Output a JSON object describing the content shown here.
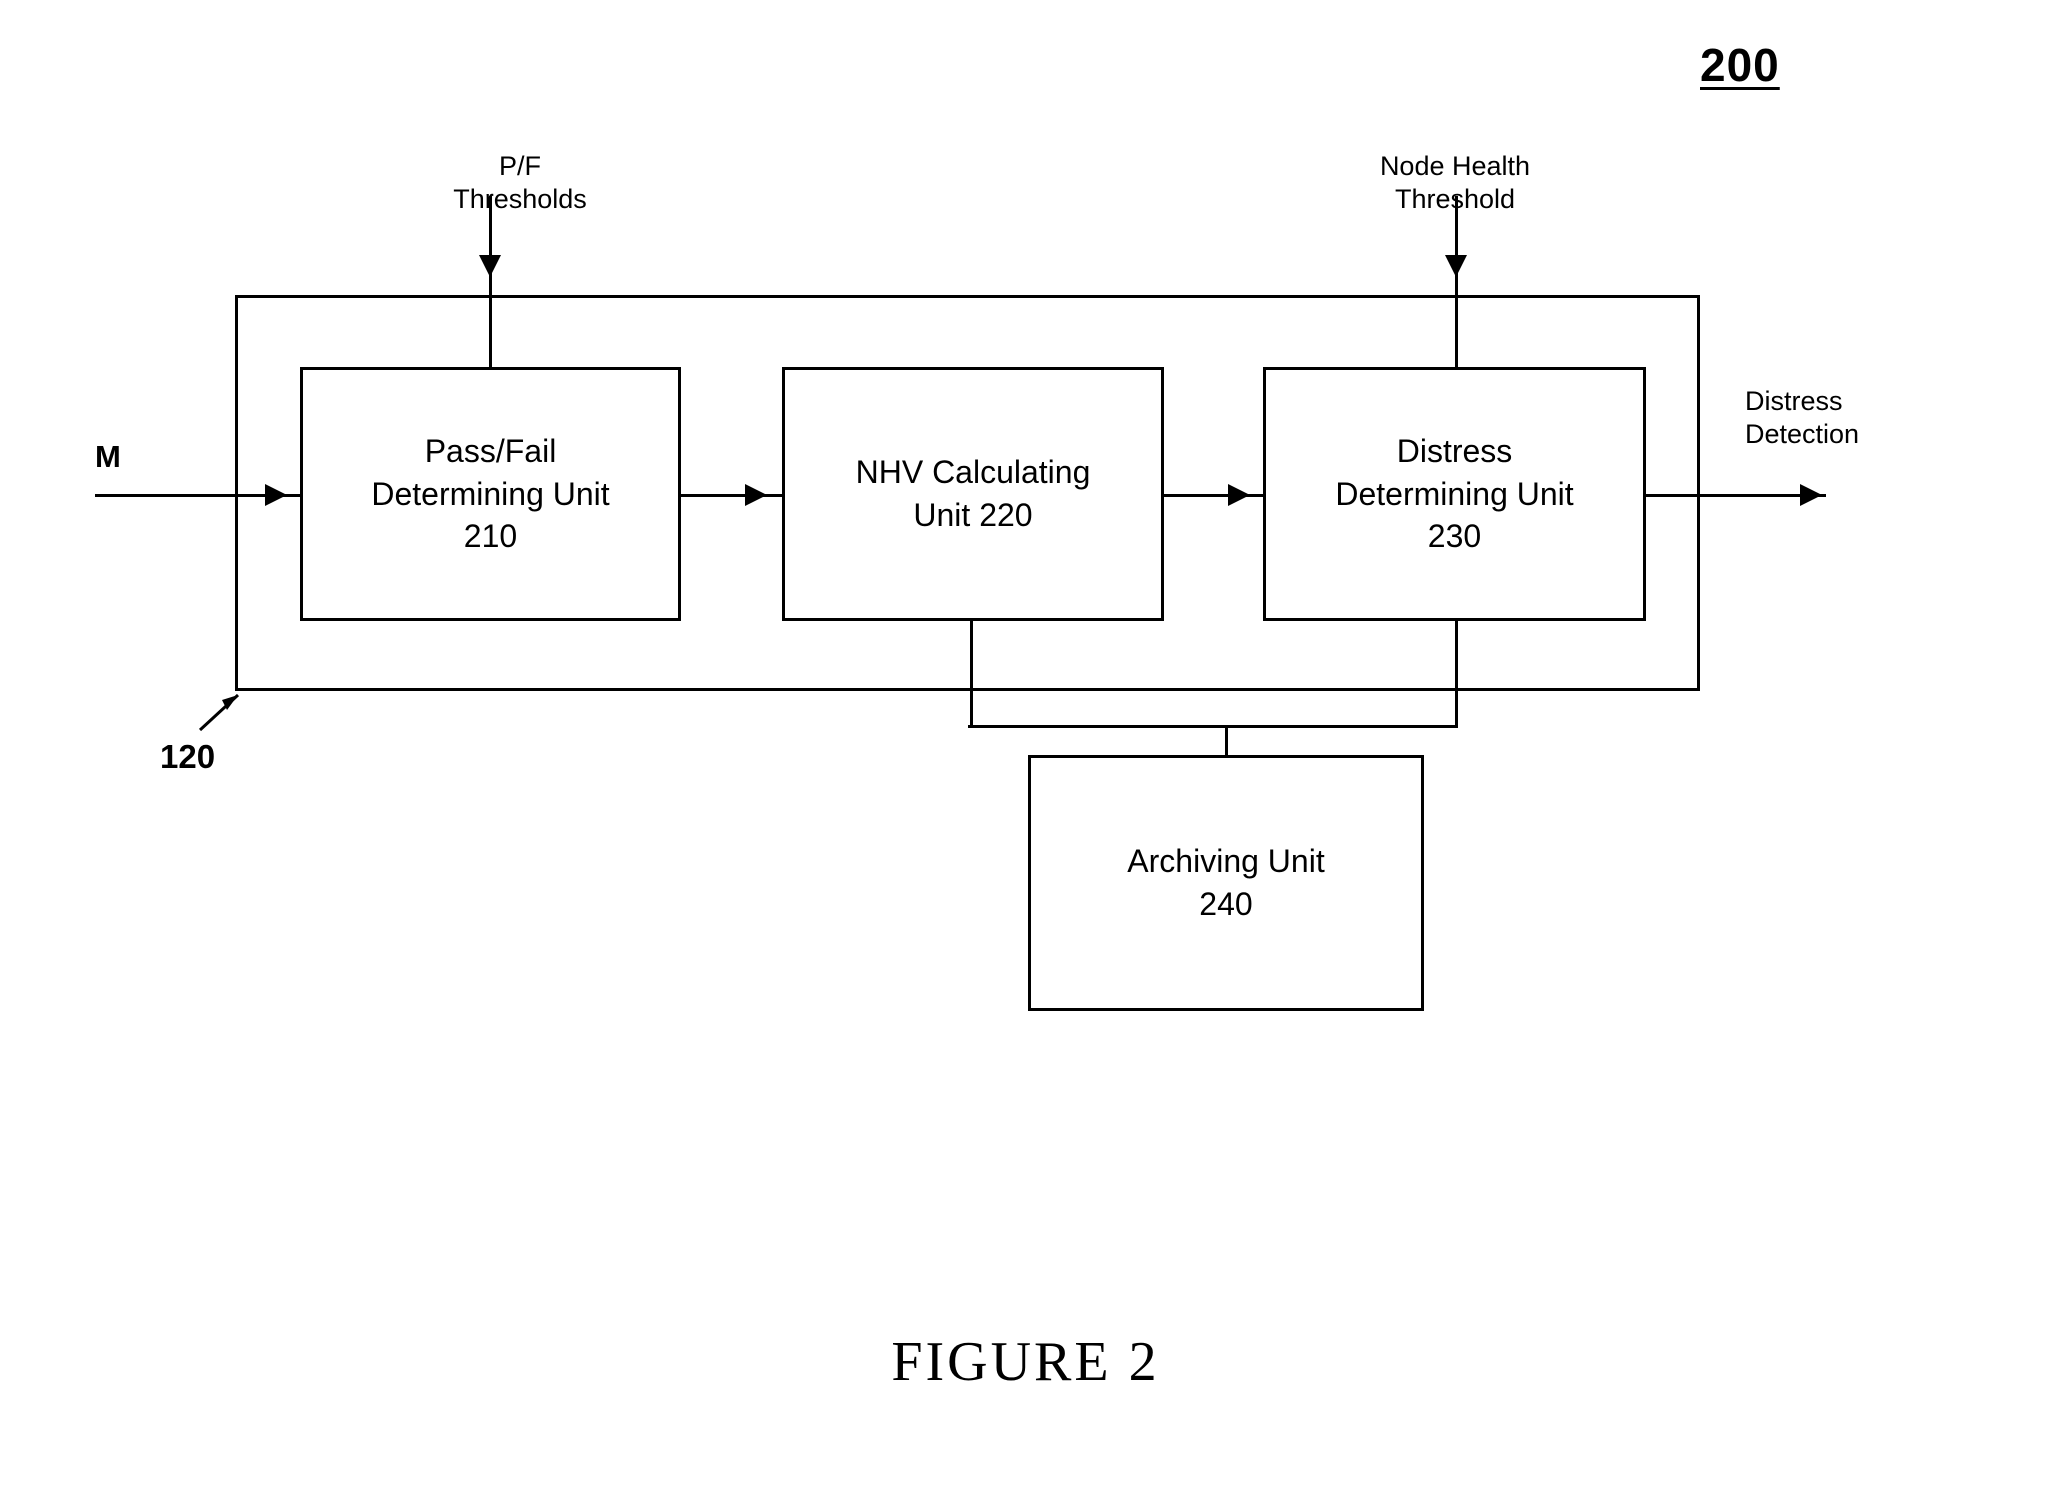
{
  "figure": {
    "reference_number": "200",
    "caption": "FIGURE 2",
    "outer_system_reference": "120"
  },
  "inputs": {
    "measurement_label": "M",
    "pf_thresholds_label": "P/F\nThresholds",
    "node_health_threshold_label": "Node Health\nThreshold"
  },
  "outputs": {
    "distress_detection_label": "Distress\nDetection"
  },
  "units": [
    {
      "id": "pass-fail-unit",
      "label": "Pass/Fail\nDetermining Unit\n210",
      "number": "210"
    },
    {
      "id": "nhv-unit",
      "label": "NHV Calculating\nUnit 220",
      "number": "220"
    },
    {
      "id": "distress-unit",
      "label": "Distress\nDetermining Unit\n230",
      "number": "230"
    },
    {
      "id": "archiving-unit",
      "label": "Archiving Unit\n240",
      "number": "240"
    }
  ],
  "colors": {
    "stroke": "#000000",
    "background": "#ffffff"
  }
}
